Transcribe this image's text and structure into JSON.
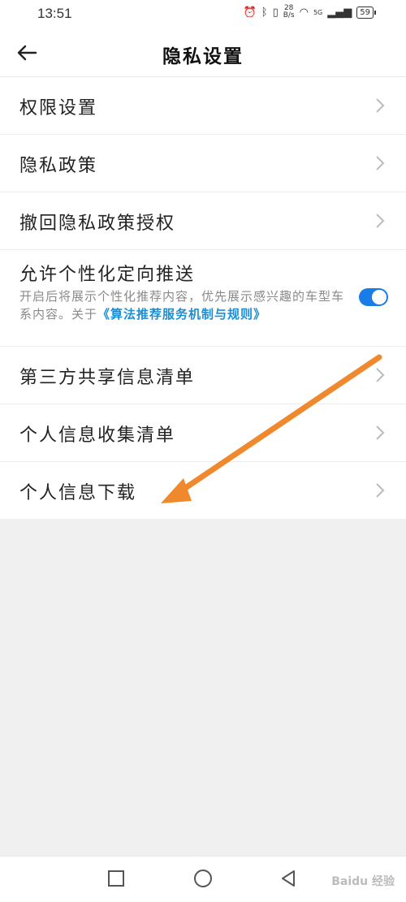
{
  "status_bar": {
    "time": "13:51",
    "net_speed_value": "28",
    "net_speed_unit": "B/s",
    "signal_label": "5G",
    "battery": "59"
  },
  "header": {
    "title": "隐私设置"
  },
  "settings": {
    "permission": "权限设置",
    "privacy_policy": "隐私政策",
    "revoke": "撤回隐私政策授权",
    "personalized": {
      "label": "允许个性化定向推送",
      "desc": "开启后将展示个性化推荐内容，优先展示感兴趣的车型车系内容。关于",
      "link": "《算法推荐服务机制与规则》",
      "enabled": true
    },
    "third_party": "第三方共享信息清单",
    "collection": "个人信息收集清单",
    "download": "个人信息下载"
  },
  "colors": {
    "accent": "#1a7ce8",
    "link": "#1a8fd6",
    "arrow": "#f0892d"
  },
  "watermark": "Baidu 经验"
}
